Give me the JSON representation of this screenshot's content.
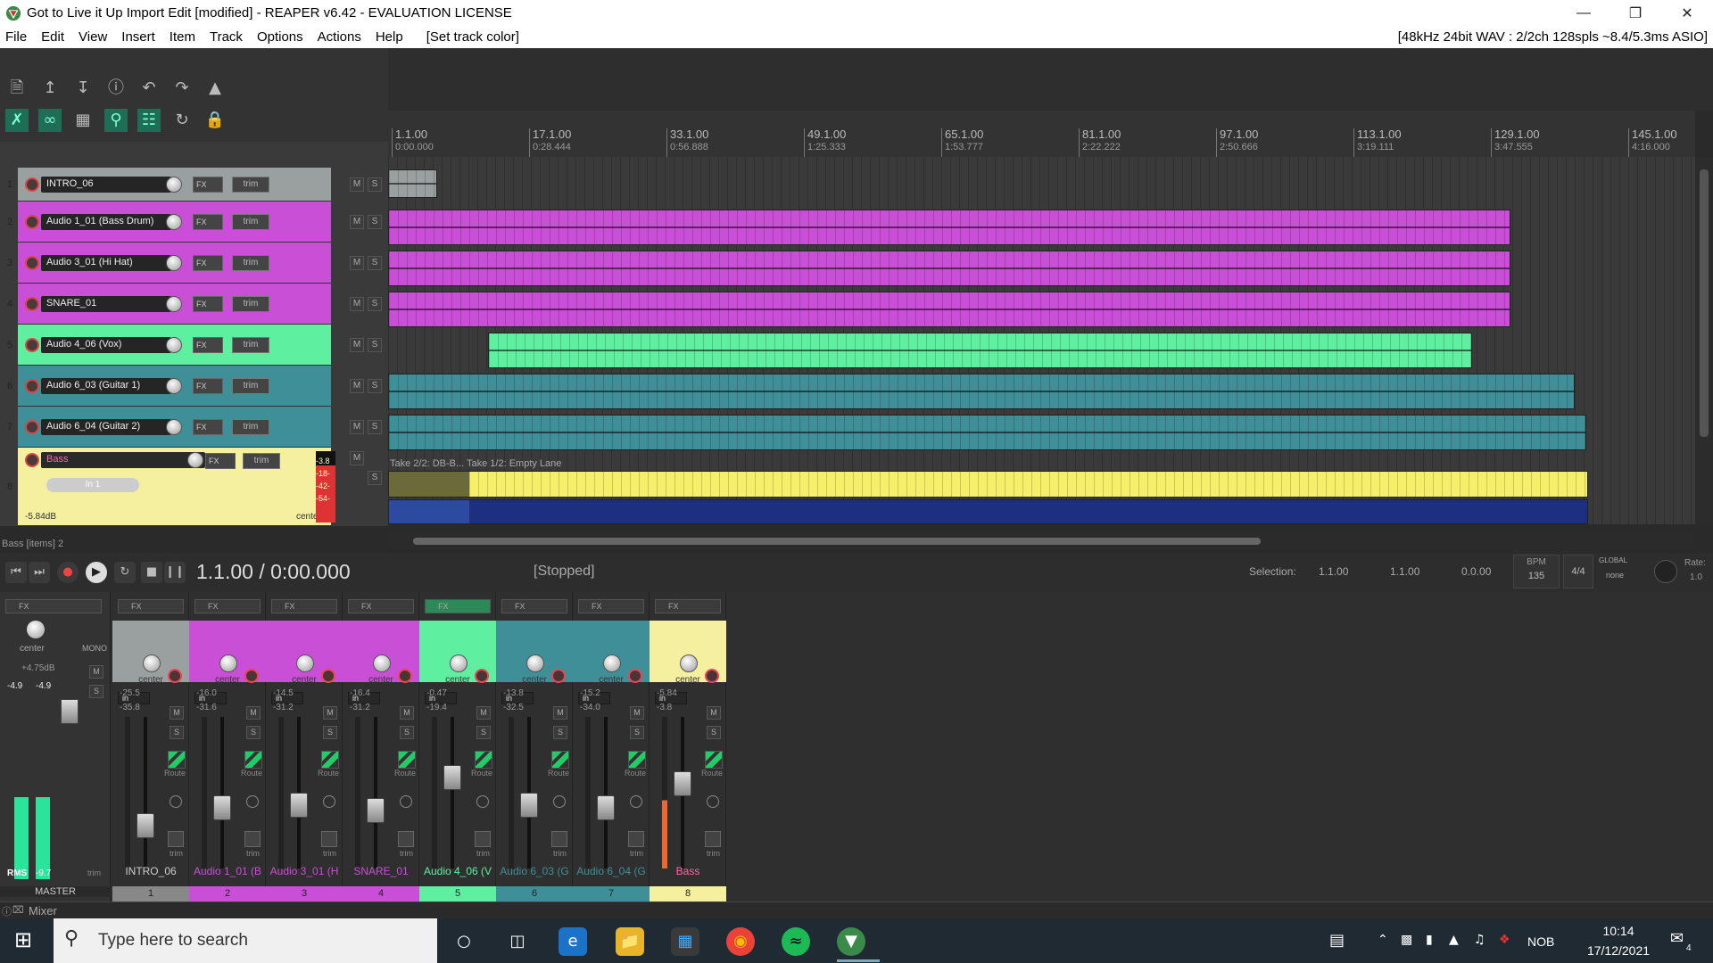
{
  "window": {
    "title": "Got to Live it Up Import Edit [modified] - REAPER v6.42 - EVALUATION LICENSE"
  },
  "menu": {
    "items": [
      "File",
      "Edit",
      "View",
      "Insert",
      "Item",
      "Track",
      "Options",
      "Actions",
      "Help",
      "[Set track color]"
    ],
    "status": "[48kHz 24bit WAV : 2/2ch 128spls ~8.4/5.3ms ASIO]"
  },
  "ruler": {
    "markers": [
      {
        "bar": "1.1.00",
        "time": "0:00.000"
      },
      {
        "bar": "17.1.00",
        "time": "0:28.444"
      },
      {
        "bar": "33.1.00",
        "time": "0:56.888"
      },
      {
        "bar": "49.1.00",
        "time": "1:25.333"
      },
      {
        "bar": "65.1.00",
        "time": "1:53.777"
      },
      {
        "bar": "81.1.00",
        "time": "2:22.222"
      },
      {
        "bar": "97.1.00",
        "time": "2:50.666"
      },
      {
        "bar": "113.1.00",
        "time": "3:19.111"
      },
      {
        "bar": "129.1.00",
        "time": "3:47.555"
      },
      {
        "bar": "145.1.00",
        "time": "4:16.000"
      }
    ]
  },
  "tracks": [
    {
      "num": "1",
      "name": "INTRO_06",
      "color": "#9aa0a0"
    },
    {
      "num": "2",
      "name": "Audio 1_01 (Bass Drum)",
      "color": "#c94fd6"
    },
    {
      "num": "3",
      "name": "Audio 3_01 (Hi Hat)",
      "color": "#c94fd6"
    },
    {
      "num": "4",
      "name": "SNARE_01",
      "color": "#c94fd6"
    },
    {
      "num": "5",
      "name": "Audio 4_06 (Vox)",
      "color": "#5ef0a0"
    },
    {
      "num": "6",
      "name": "Audio 6_03 (Guitar 1)",
      "color": "#3f8f98"
    },
    {
      "num": "7",
      "name": "Audio 6_04 (Guitar 2)",
      "color": "#3f8f98"
    },
    {
      "num": "8",
      "name": "Bass",
      "color": "#f5f0a0"
    }
  ],
  "tcp": {
    "fx": "FX",
    "trim": "trim",
    "mute": "M",
    "solo": "S",
    "bass_input": "In 1",
    "bass_in": "in",
    "bass_vol": "-5.84dB",
    "bass_pan": "center",
    "bass_fx": "FX",
    "bass_meter": [
      "-3.8",
      "-18-",
      "-42-",
      "-54-"
    ]
  },
  "take_label": "Take 2/2: DB-B... Take 1/2: Empty Lane",
  "status_left": "Bass [items] 2",
  "transport": {
    "position": "1.1.00 / 0:00.000",
    "state": "[Stopped]",
    "selection_label": "Selection:",
    "sel_start": "1.1.00",
    "sel_end": "1.1.00",
    "sel_len": "0.0.00",
    "bpm_label": "BPM",
    "bpm": "135",
    "timesig": "4/4",
    "global_label": "GLOBAL",
    "global_val": "none",
    "rate_label": "Rate:",
    "rate": "1.0"
  },
  "mixer": {
    "master": {
      "name": "MASTER",
      "pan": "center",
      "mono": "MONO",
      "vol": "+4.75dB",
      "peak_l": "-4.9",
      "peak_r": "-4.9",
      "rms_label": "RMS",
      "rms": "-9.7",
      "trim": "trim",
      "fx": "FX"
    },
    "strips": [
      {
        "name": "INTRO_06",
        "num": "1",
        "vol": "-25.5",
        "peak": "-35.8",
        "pan": "center",
        "fx": "FX",
        "in": "in",
        "route": "Route",
        "trim": "trim",
        "fader": 0.28
      },
      {
        "name": "Audio 1_01 (B",
        "num": "2",
        "vol": "-16.0",
        "peak": "-31.6",
        "pan": "center",
        "fx": "FX",
        "in": "in",
        "route": "Route",
        "trim": "trim",
        "fader": 0.4
      },
      {
        "name": "Audio 3_01 (H",
        "num": "3",
        "vol": "-14.5",
        "peak": "-31.2",
        "pan": "center",
        "fx": "FX",
        "in": "in",
        "route": "Route",
        "trim": "trim",
        "fader": 0.42
      },
      {
        "name": "SNARE_01",
        "num": "4",
        "vol": "-16.4",
        "peak": "-31.2",
        "pan": "center",
        "fx": "FX",
        "in": "in",
        "route": "Route",
        "trim": "trim",
        "fader": 0.38
      },
      {
        "name": "Audio 4_06 (V",
        "num": "5",
        "vol": "-0.47",
        "peak": "-19.4",
        "pan": "center",
        "fx": "FX",
        "in": "in",
        "route": "Route",
        "trim": "trim",
        "fader": 0.6
      },
      {
        "name": "Audio 6_03 (G",
        "num": "6",
        "vol": "-13.8",
        "peak": "-32.5",
        "pan": "center",
        "fx": "FX",
        "in": "in",
        "route": "Route",
        "trim": "trim",
        "fader": 0.42
      },
      {
        "name": "Audio 6_04 (G",
        "num": "7",
        "vol": "-15.2",
        "peak": "-34.0",
        "pan": "center",
        "fx": "FX",
        "in": "in",
        "route": "Route",
        "trim": "trim",
        "fader": 0.4
      },
      {
        "name": "Bass",
        "num": "8",
        "vol": "-5.84",
        "peak": "-3.8",
        "pan": "center",
        "fx": "FX",
        "in": "in",
        "route": "Route",
        "trim": "trim",
        "fader": 0.56
      }
    ],
    "button_labels": {
      "mute": "M",
      "solo": "S"
    },
    "tab": "Mixer"
  },
  "taskbar": {
    "search": "Type here to search",
    "lang": "NOB",
    "time": "10:14",
    "date": "17/12/2021",
    "notif": "4"
  }
}
